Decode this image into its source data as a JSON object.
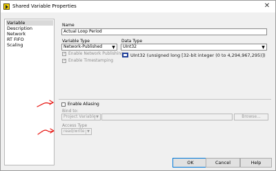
{
  "window": {
    "title": "Shared Variable Properties",
    "close_glyph": "✕"
  },
  "sidebar": {
    "items": [
      {
        "label": "Variable"
      },
      {
        "label": "Description"
      },
      {
        "label": "Network"
      },
      {
        "label": "RT FIFO"
      },
      {
        "label": "Scaling"
      }
    ]
  },
  "variable": {
    "name_label": "Name",
    "name_value": "Actual Loop Period",
    "variable_type_label": "Variable Type",
    "variable_type_value": "Network-Published",
    "data_type_label": "Data Type",
    "data_type_value": "UInt32",
    "data_type_description": "UInt32 (unsigned long [32-bit integer (0 to 4,294,967,295)])",
    "enable_network_publishing_label": "Enable Network Publishing",
    "enable_network_publishing_checked": true,
    "enable_timestamping_label": "Enable Timestamping",
    "enable_timestamping_checked": true
  },
  "aliasing": {
    "enable_aliasing_label": "Enable Aliasing",
    "enable_aliasing_checked": false,
    "bind_to_label": "Bind to:",
    "bind_to_value": "Project Variable",
    "browse_label": "Browse...",
    "access_type_label": "Access Type",
    "access_type_value": "read/write"
  },
  "buttons": {
    "ok_label": "OK",
    "cancel_label": "Cancel",
    "help_label": "Help"
  },
  "icons": {
    "app_icon": "labview-app-icon",
    "data_type_icon": "uint32-type-icon",
    "dropdown": "chevron-down-icon"
  },
  "colors": {
    "annotation_arrow": "#e8201c",
    "data_type_icon": "#1f3f99",
    "default_button_border": "#0078d7"
  }
}
